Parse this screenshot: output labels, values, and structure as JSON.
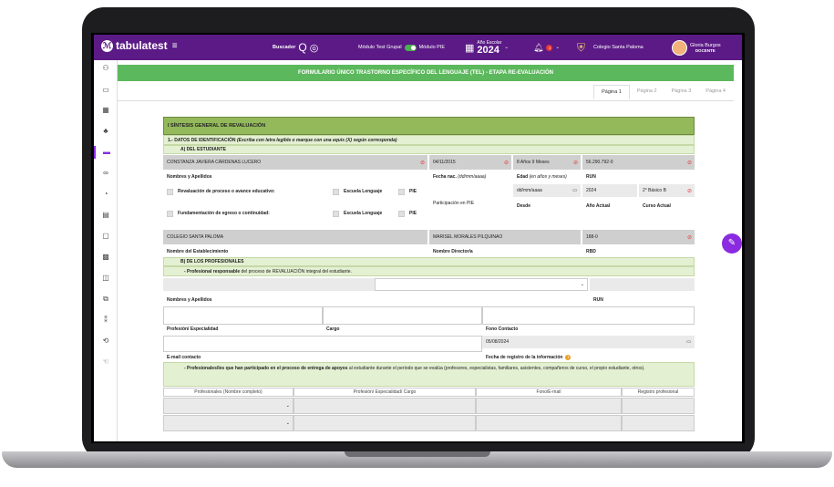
{
  "app": {
    "logo_text": "tabulatest",
    "search_label": "Buscador",
    "mode_group_label": "Módulo Test Grupal",
    "mode_pie_label": "Módulo PIE",
    "year_label": "Año Escolar",
    "year_value": "2024",
    "notif_count": "3",
    "school_name": "Colegio Santa Paloma",
    "user_name": "Gloria Burgos",
    "user_role": "DOCENTE"
  },
  "page": {
    "title": "FORMULARIO ÚNICO TRASTORNO ESPECÍFICO DEL LENGUAJE (TEL) - ETAPA RE-EVALUACIÓN",
    "tabs": [
      "Página 1",
      "Página 2",
      "Página 3",
      "Página 4"
    ]
  },
  "form": {
    "section1": "I   SÍNTESIS GENERAL DE REVALUACIÓN",
    "sub1": "1.- DATOS DE IDENTIFICACIÓN",
    "sub1_note": "(Escriba con letra legible o marque con una equis (X) según corresponda)",
    "subA": "A)    DEL ESTUDIANTE",
    "student_name": "CONSTANZA JAVIERA CÁRDENAS LUCERO",
    "birth_date": "04/11/2015",
    "age": "8 Años 9 Meses",
    "run": "56.290.792-0",
    "lbl_name": "Nombres y Apellidos",
    "lbl_birth": "Fecha nac.",
    "lbl_birth_hint": "(dd/mm/aaaa)",
    "lbl_age": "Edad",
    "lbl_age_hint": "(en años y meses)",
    "lbl_run": "RUN",
    "chk1": "Revaluación de proceso o avance educativo:",
    "chk2": "Fundamentación de egreso o continuidad:",
    "escuela_lenguaje": "Escuela Lenguaje",
    "pie": "PIE",
    "participation": "Participación en PIE",
    "date_placeholder": "dd/mm/aaaa",
    "current_year": "2024",
    "current_course": "2° Básico B",
    "lbl_desde": "Desde",
    "lbl_anio": "Año Actual",
    "lbl_curso": "Curso Actual",
    "school": "COLEGIO SANTA PALOMA",
    "director": "MARISEL MORALES PILQUINAO",
    "rbd": "188-0",
    "lbl_school": "Nombre del Establecimiento",
    "lbl_director": "Nombre Director/a",
    "lbl_rbd": "RBD",
    "subB": "B)    DE LOS PROFESIONALES",
    "resp_bold": "- Profesional responsable",
    "resp_rest": "del proceso de REVALUACIÓN integral del estudiante.",
    "lbl_prof_name": "Nombres y Apellidos",
    "lbl_prof_run": "RUN",
    "lbl_prof_esp": "Profesión/ Especialidad",
    "lbl_cargo": "Cargo",
    "lbl_fono": "Fono Contacto",
    "reg_date": "05/08/2024",
    "lbl_email": "E-mail contacto",
    "lbl_reg_date": "Fecha de registro de la información",
    "part_bold": "- Profesionales/les que han participado en el proceso de entrega de apoyos",
    "part_rest": "al estudiante durante el período que se evalúa (profesores, especialistas, familiares, asistentes, compañeros de curso, el propio estudiante, otros).",
    "tbl_cols": [
      "Profesionales (Nombre completo)",
      "Profesión/ Especialidad/ Cargo",
      "Fono/E-mail",
      "Registro profesional"
    ]
  },
  "sidebar_icons": [
    "users-icon",
    "id-card-icon",
    "calculator-icon",
    "users-group-icon",
    "folder-icon",
    "link-icon",
    "brain-icon",
    "document-icon",
    "clipboard-icon",
    "grid-icon",
    "book-icon",
    "copy-icon",
    "hierarchy-icon",
    "share-icon",
    "hand-icon"
  ]
}
